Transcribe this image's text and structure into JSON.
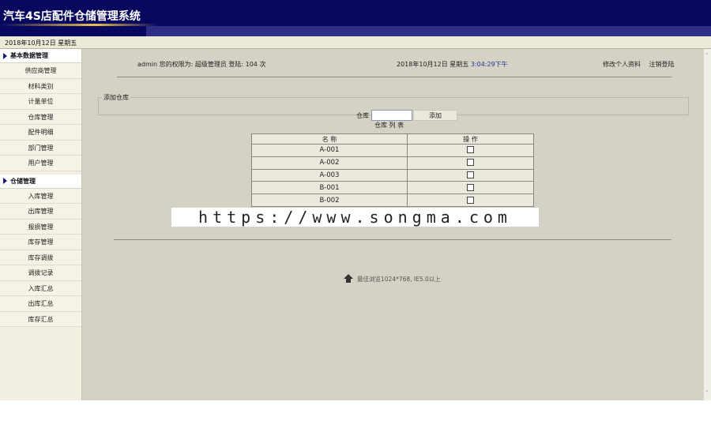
{
  "app": {
    "title": "汽车4S店配件仓储管理系统"
  },
  "datebar": {
    "date": "2018年10月12日 星期五"
  },
  "sidebar": {
    "groups": [
      {
        "title": "基本数据管理",
        "items": [
          "供应商管理",
          "材料类别",
          "计量单位",
          "仓库管理",
          "配件明细",
          "部门管理",
          "用户管理"
        ]
      },
      {
        "title": "仓储管理",
        "items": [
          "入库管理",
          "出库管理",
          "报损管理",
          "库存管理",
          "库存调拨",
          "调拨记录",
          "入库汇总",
          "出库汇总",
          "库存汇总"
        ]
      }
    ]
  },
  "infobar": {
    "user_text": "admin 您的权限为: 超级管理员 登陆: 104 次",
    "date_text": "2018年10月12日 星期五",
    "clock": "3:04:29下午",
    "edit_profile": "修改个人资料",
    "logout": "注销登陆"
  },
  "add_form": {
    "legend": "添加仓库",
    "label": "仓库",
    "value": "",
    "button": "添加"
  },
  "list": {
    "title": "仓库 列 表",
    "headers": [
      "名 称",
      "操 作"
    ],
    "rows": [
      "A-001",
      "A-002",
      "A-003",
      "B-001",
      "B-002"
    ]
  },
  "footer": {
    "text": "最佳浏览1024*768, IE5.0以上"
  },
  "watermark": {
    "text": "https://www.songma.com"
  }
}
